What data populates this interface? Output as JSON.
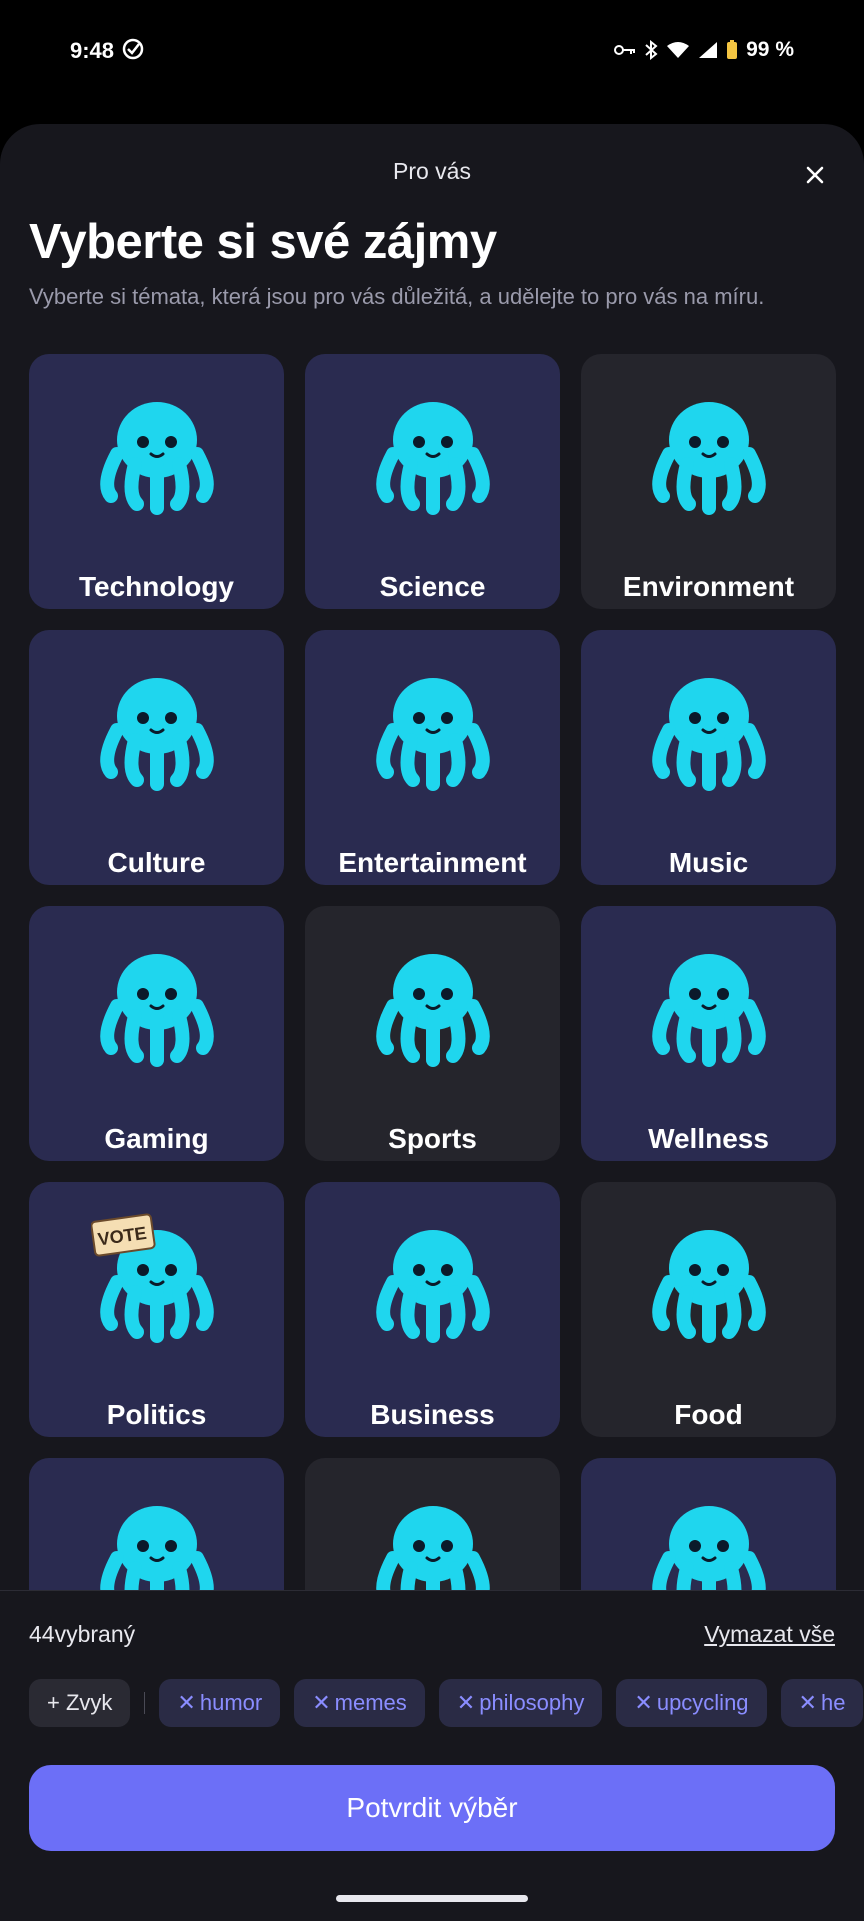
{
  "status": {
    "time": "9:48",
    "battery": "99 %"
  },
  "sheet": {
    "title": "Pro vás"
  },
  "headline": "Vyberte si své zájmy",
  "subline": "Vyberte si témata, která jsou pro vás důležitá, a udělejte to pro vás na míru.",
  "categories": [
    {
      "label": "Technology",
      "selected": true,
      "accessory": "laptop-icon"
    },
    {
      "label": "Science",
      "selected": true,
      "accessory": "flask-icon"
    },
    {
      "label": "Environment",
      "selected": false,
      "accessory": "globe-icon"
    },
    {
      "label": "Culture",
      "selected": true,
      "accessory": "palette-icon"
    },
    {
      "label": "Entertainment",
      "selected": true,
      "accessory": "popcorn-icon"
    },
    {
      "label": "Music",
      "selected": true,
      "accessory": "guitar-icon"
    },
    {
      "label": "Gaming",
      "selected": true,
      "accessory": "gamepad-icon"
    },
    {
      "label": "Sports",
      "selected": false,
      "accessory": "racecar-icon"
    },
    {
      "label": "Wellness",
      "selected": true,
      "accessory": "yoga-mat-icon"
    },
    {
      "label": "Politics",
      "selected": true,
      "accessory": "vote-sign-icon",
      "sign_text": "VOTE"
    },
    {
      "label": "Business",
      "selected": true,
      "accessory": "suit-icon"
    },
    {
      "label": "Food",
      "selected": false,
      "accessory": "chef-hat-icon"
    },
    {
      "label": "",
      "selected": true,
      "accessory": "window-icon"
    },
    {
      "label": "",
      "selected": false,
      "accessory": "octopus-icon"
    },
    {
      "label": "",
      "selected": true,
      "accessory": "book-icon"
    }
  ],
  "bottom": {
    "count": "44vybraný",
    "clear_all": "Vymazat vše",
    "add_chip": "+ Zvyk",
    "tags": [
      "humor",
      "memes",
      "philosophy",
      "upcycling",
      "he"
    ],
    "confirm": "Potvrdit výběr"
  },
  "colors": {
    "accent": "#6c6ff7",
    "selected_card": "#2a2b50",
    "unselected_card": "#25252c",
    "mascot": "#1fd6ee"
  }
}
